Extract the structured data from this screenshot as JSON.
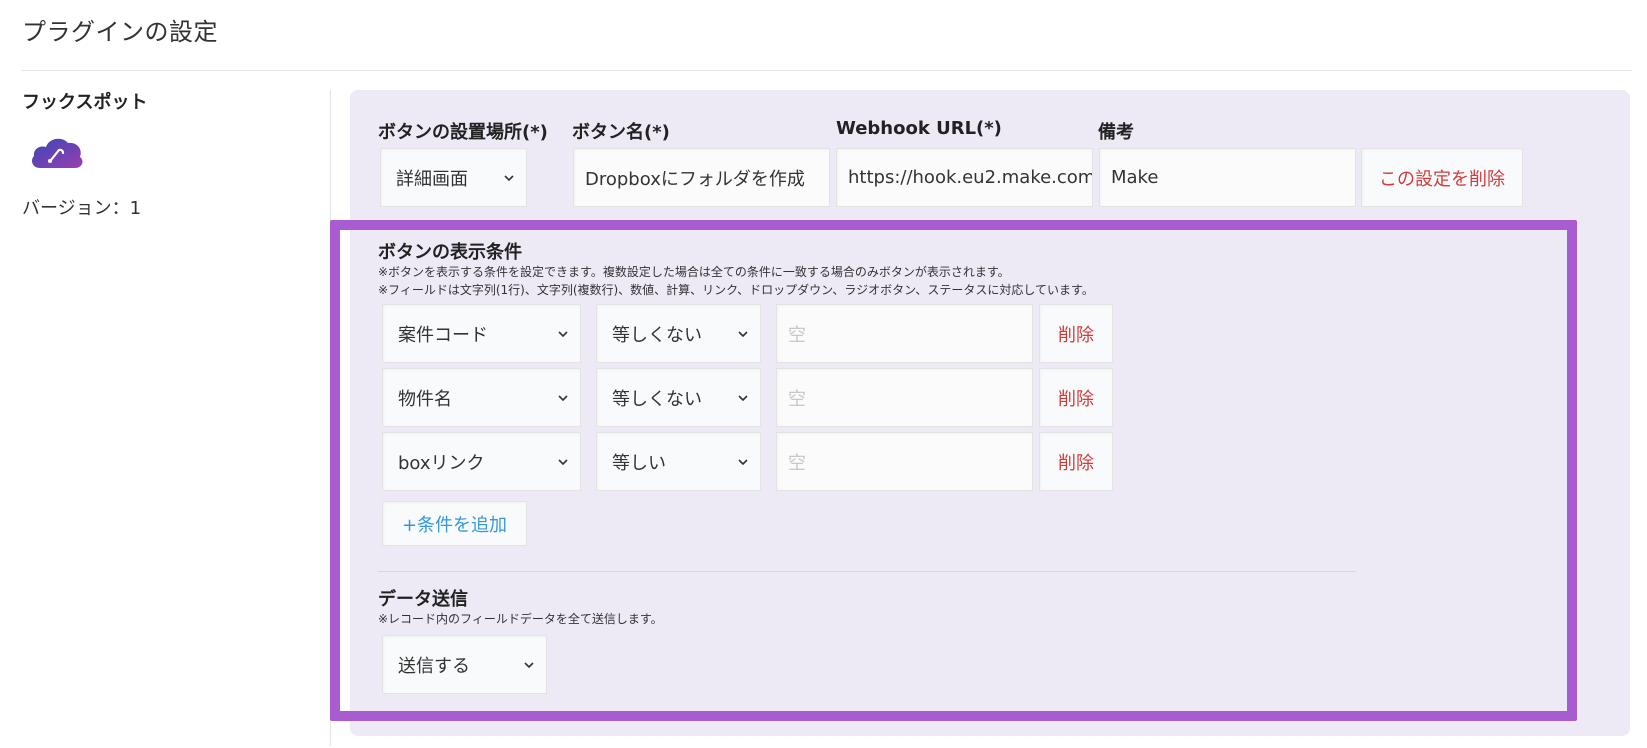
{
  "page": {
    "title": "プラグインの設定"
  },
  "plugin": {
    "name": "フックスポット",
    "version_label": "バージョン：",
    "version_value": "1",
    "icon": "cloud-hook-logo"
  },
  "button_config": {
    "location_label": "ボタンの設置場所(*)",
    "location_value": "詳細画面",
    "name_label": "ボタン名(*)",
    "name_value": "Dropboxにフォルダを作成",
    "webhook_label": "Webhook URL(*)",
    "webhook_value": "https://hook.eu2.make.com",
    "remarks_label": "備考",
    "remarks_value": "Make",
    "delete_label": "この設定を削除"
  },
  "display_conditions": {
    "title": "ボタンの表示条件",
    "note1": "※ボタンを表示する条件を設定できます。複数設定した場合は全ての条件に一致する場合のみボタンが表示されます。",
    "note2": "※フィールドは文字列(1行)、文字列(複数行)、数値、計算、リンク、ドロップダウン、ラジオボタン、ステータスに対応しています。",
    "rows": [
      {
        "field": "案件コード",
        "operator": "等しくない",
        "value_placeholder": "空",
        "delete_label": "削除"
      },
      {
        "field": "物件名",
        "operator": "等しくない",
        "value_placeholder": "空",
        "delete_label": "削除"
      },
      {
        "field": "boxリンク",
        "operator": "等しい",
        "value_placeholder": "空",
        "delete_label": "削除"
      }
    ],
    "add_label": "+条件を追加"
  },
  "data_send": {
    "title": "データ送信",
    "note": "※レコード内のフィールドデータを全て送信します。",
    "value": "送信する"
  },
  "colors": {
    "panel_bg": "#edeaf6",
    "highlight_border": "#a95bd0",
    "danger_text": "#d03c3c",
    "link_text": "#3498db"
  }
}
